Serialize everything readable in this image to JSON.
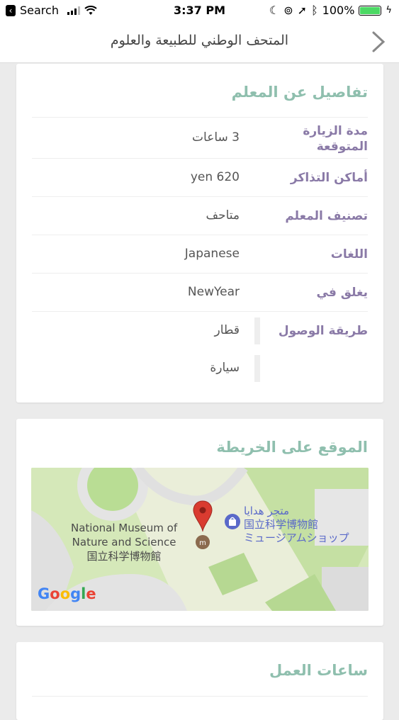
{
  "status": {
    "carrier": "Search",
    "time": "3:37 PM",
    "battery_pct": "100%",
    "battery_fill": 1.0
  },
  "nav": {
    "title": "المتحف الوطني للطبيعة والعلوم"
  },
  "details": {
    "title": "تفاصيل عن المعلم",
    "rows": [
      {
        "label": "مدة الزيارة المتوقعة",
        "value": "3 ساعات"
      },
      {
        "label": "أماكن التذاكر",
        "value": "620 yen"
      },
      {
        "label": "تصنيف المعلم",
        "value": "متاحف"
      },
      {
        "label": "اللغات",
        "value": "Japanese"
      },
      {
        "label": "يغلق في",
        "value": "NewYear"
      },
      {
        "label": "طريقة الوصول",
        "value": "قطار"
      },
      {
        "label": "",
        "value": "سيارة"
      }
    ]
  },
  "map_section": {
    "title": "الموقع على الخريطة",
    "place_label": [
      "National Museum of",
      "Nature and Science",
      "国立科学博物館"
    ],
    "shop_label": [
      "متجر هدايا",
      "国立科学博物館",
      "ミュージアムショップ"
    ],
    "attribution": "Google",
    "colors": {
      "pin": "#d93b30",
      "shop": "#5a69c9",
      "park": "#cfe3b1"
    }
  },
  "hours": {
    "title": "ساعات العمل"
  }
}
